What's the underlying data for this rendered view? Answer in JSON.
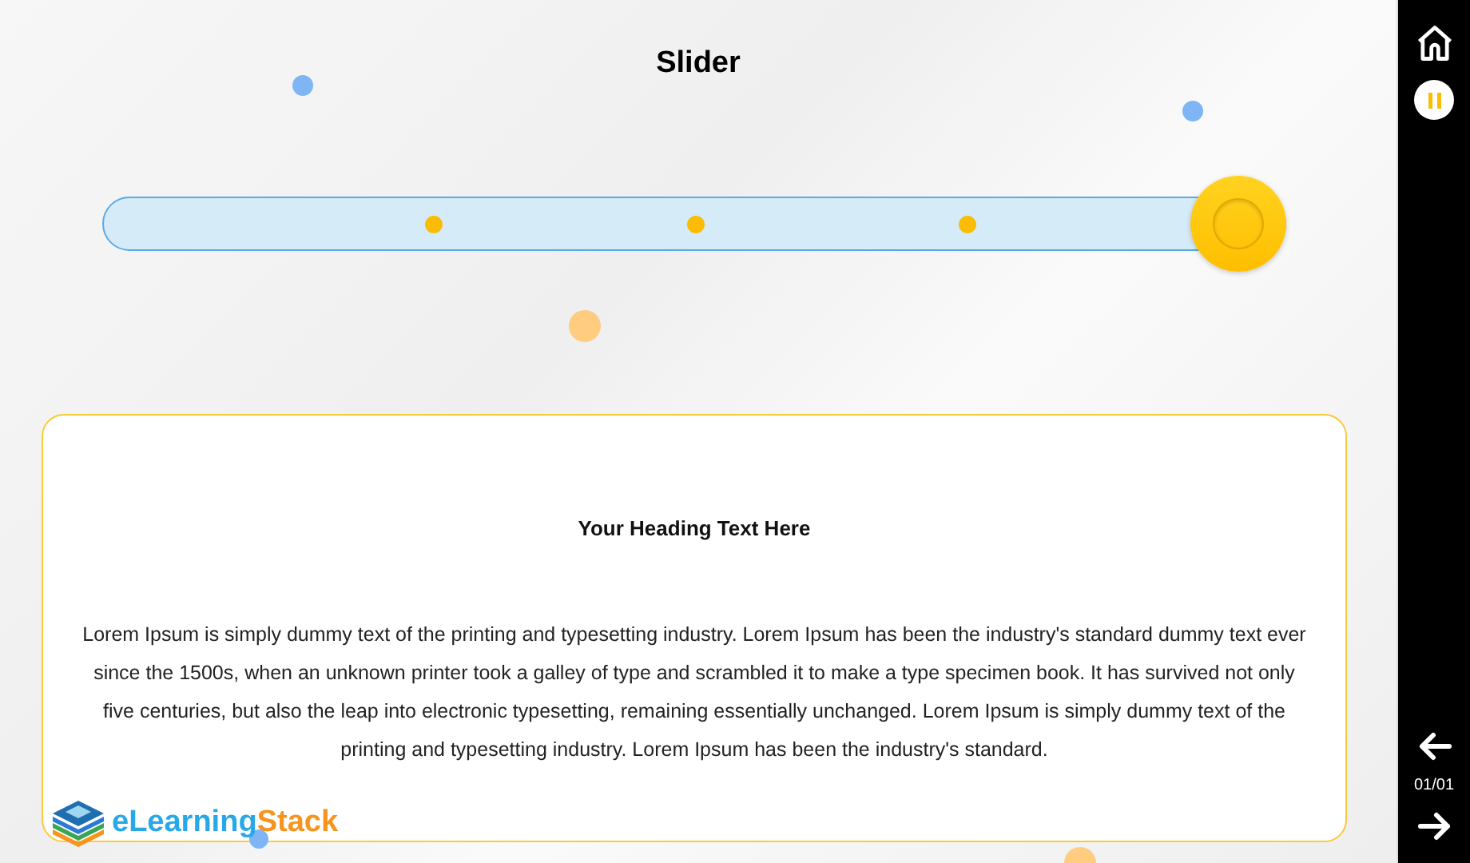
{
  "title": "Slider",
  "card": {
    "heading": "Your Heading Text Here",
    "body": "Lorem Ipsum is simply dummy text of the printing and typesetting industry. Lorem Ipsum has been the industry's standard dummy text ever since the 1500s, when an unknown printer took a galley of type and scrambled it to make a type specimen book. It has survived not only five centuries, but also the leap into electronic typesetting, remaining essentially unchanged. Lorem Ipsum is simply dummy text of the printing and typesetting industry. Lorem Ipsum has been the industry's standard."
  },
  "logo": {
    "part_1": "eLearning",
    "part_2": "Stack"
  },
  "sidebar": {
    "page_counter": "01/01"
  }
}
